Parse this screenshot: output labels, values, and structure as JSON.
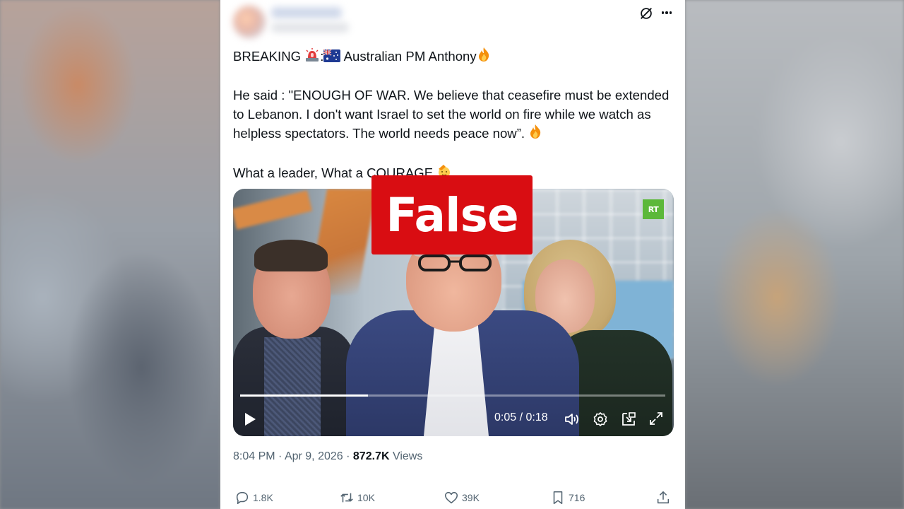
{
  "tweet": {
    "line1_text": "BREAKING",
    "line1_sep": ":",
    "line1_rest": "Australian PM Anthony",
    "quote": "He said : \"ENOUGH OF WAR. We believe that ceasefire must be extended to Lebanon. I don't want Israel to set the world on fire while we watch as helpless spectators. The world needs peace now”.",
    "closing": "What a leader, What a COURAGE",
    "emojis": {
      "siren": "siren-emoji",
      "flag": "australia-flag-emoji",
      "fire": "🔥",
      "clap": "saluting-emoji"
    }
  },
  "video": {
    "channel_logo": "RT",
    "time_display": "0:05 / 0:18",
    "progress": 0.3
  },
  "meta": {
    "time": "8:04 PM",
    "separator": "·",
    "date": "Apr 9, 2026",
    "views_count": "872.7K",
    "views_label": "Views"
  },
  "actions": {
    "replies": "1.8K",
    "reposts": "10K",
    "likes": "39K",
    "bookmarks": "716"
  },
  "overlay": {
    "verdict": "False",
    "color": "#d90d12"
  }
}
